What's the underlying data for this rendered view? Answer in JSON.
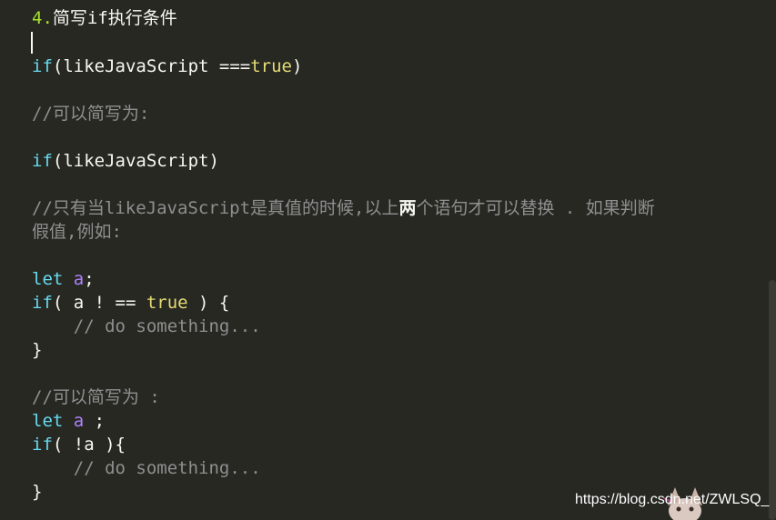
{
  "lines": {
    "l1_num": "4.",
    "l1_text": "简写if执行条件",
    "l2_if": "if",
    "l2_rest": "(likeJavaScript ===",
    "l2_true": "true",
    "l2_close": ")",
    "l3_comment": "//可以简写为:",
    "l4_if": "if",
    "l4_rest": "(likeJavaScript)",
    "l5_comment_a": "//只有当likeJavaScript是真值的时候,以上",
    "l5_comment_bold": "两",
    "l5_comment_b": "个语句才可以替换 . 如果判断",
    "l6_comment": "假值,例如:",
    "l7_let": "let",
    "l7_var": " a",
    "l7_semi": ";",
    "l8_if": "if",
    "l8_rest_a": "( a ! == ",
    "l8_true": "true",
    "l8_rest_b": " ) {",
    "l9_comment": "    // do something...",
    "l10_brace": "}",
    "l11_comment": "//可以简写为 :",
    "l12_let": "let",
    "l12_var": " a",
    "l12_semi": " ;",
    "l13_if": "if",
    "l13_rest": "( !a ){",
    "l14_comment": "    // do something...",
    "l15_brace": "}"
  },
  "watermark": "https://blog.csdn.net/ZWLSQ_",
  "colors": {
    "background": "#272822",
    "keyword": "#66d9ef",
    "boolean": "#e6db74",
    "comment": "#8f8f8f",
    "variable": "#ae81ff",
    "heading_number": "#a6e22e"
  }
}
